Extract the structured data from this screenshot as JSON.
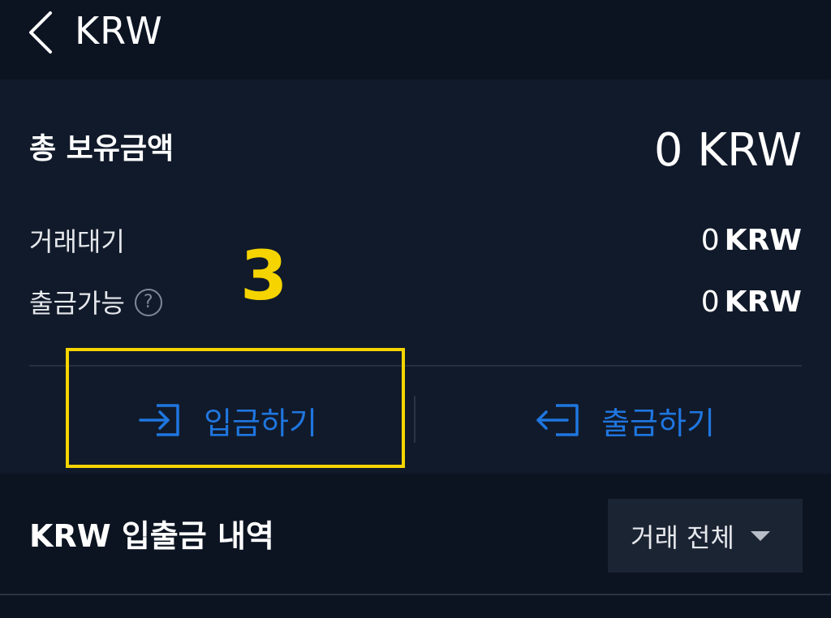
{
  "header": {
    "title": "KRW"
  },
  "summary": {
    "total_label": "총 보유금액",
    "total_value": "0 KRW",
    "rows": [
      {
        "label": "거래대기",
        "amount": "0",
        "unit": "KRW"
      },
      {
        "label": "출금가능",
        "amount": "0",
        "unit": "KRW",
        "help": "?"
      }
    ]
  },
  "actions": {
    "deposit_label": "입금하기",
    "withdraw_label": "출금하기",
    "accent_color": "#1f76e0"
  },
  "annotation": {
    "step_number": "3",
    "color": "#f5d400"
  },
  "history": {
    "title": "KRW 입출금 내역",
    "filter_selected": "거래 전체"
  }
}
